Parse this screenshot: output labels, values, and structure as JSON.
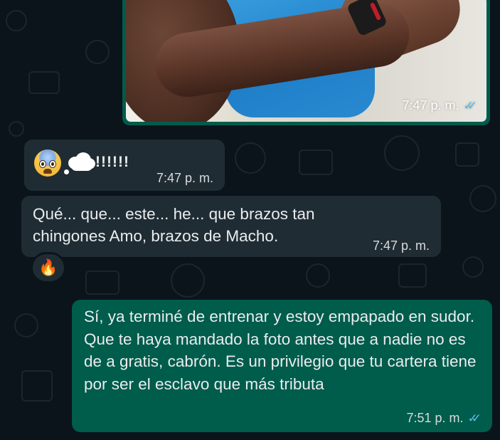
{
  "messages": {
    "image_message": {
      "time": "7:47 p. m.",
      "status_icon": "double-check-read-icon"
    },
    "incoming_1": {
      "emojis": [
        "flushed-face-icon",
        "thought-balloon-icon"
      ],
      "text": "!!!!!!",
      "time": "7:47 p. m."
    },
    "incoming_2": {
      "text": "Qué... que... este... he... que brazos tan chingones Amo, brazos de Macho.",
      "time": "7:47 p. m.",
      "reaction": "🔥"
    },
    "outgoing_1": {
      "text": "Sí, ya terminé de entrenar y estoy empapado en sudor. Que te haya mandado la foto antes que a nadie no es de a gratis, cabrón. Es un privilegio que tu cartera tiene por ser el esclavo que más tributa",
      "time": "7:51 p. m.",
      "status_icon": "double-check-read-icon"
    }
  },
  "colors": {
    "background": "#0b141a",
    "incoming_bubble": "#202c33",
    "outgoing_bubble": "#005c4b",
    "read_check": "#53bdeb"
  }
}
